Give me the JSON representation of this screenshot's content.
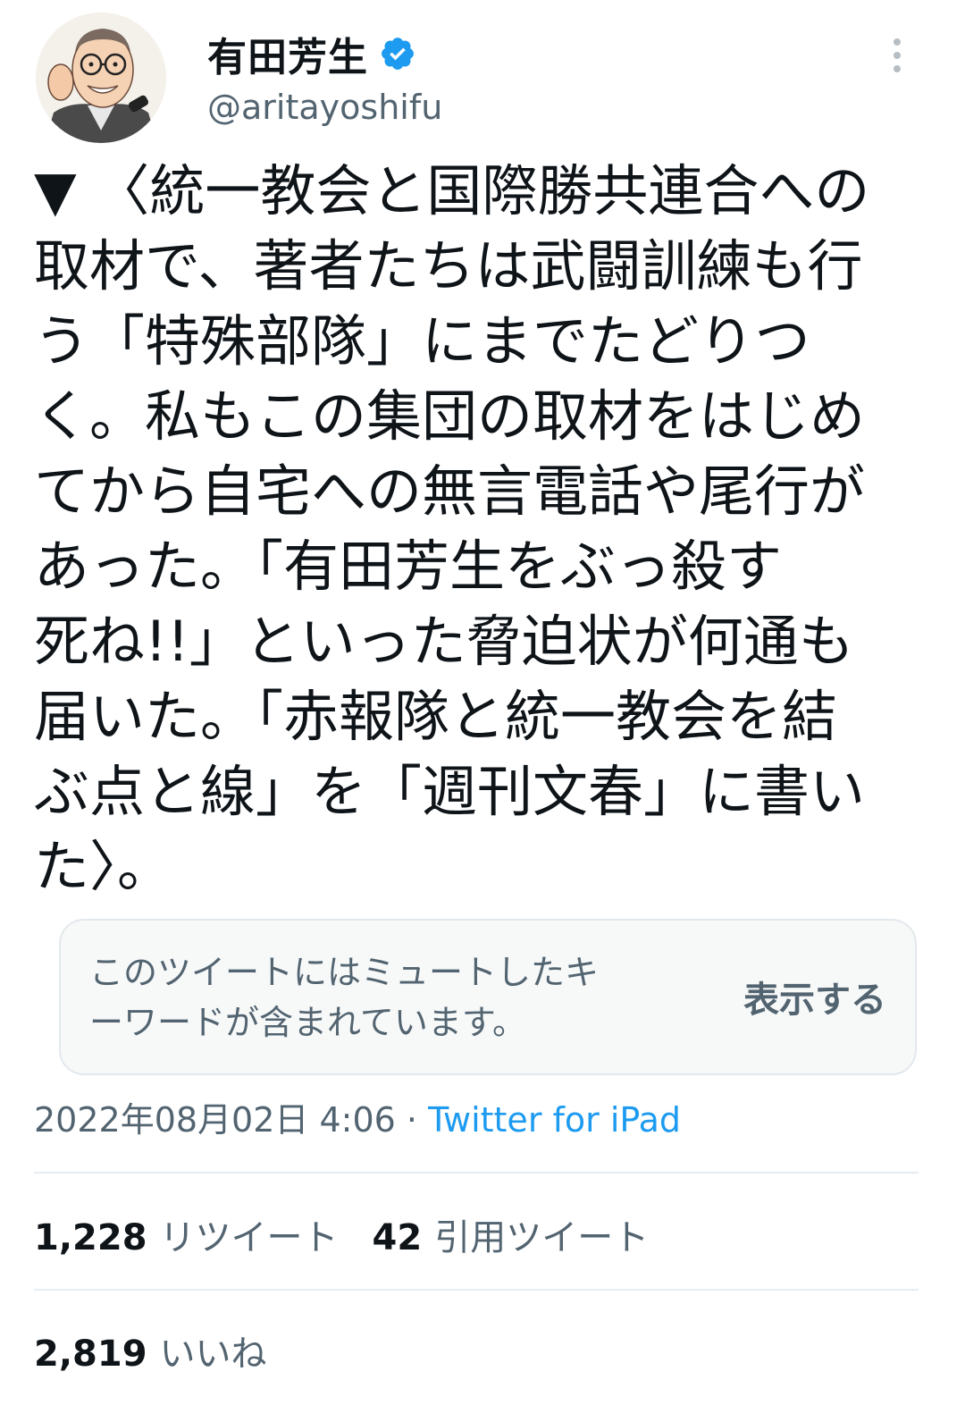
{
  "author": {
    "display_name": "有田芳生",
    "handle": "@aritayoshifu",
    "verified_color": "#1d9bf0"
  },
  "tweet": {
    "lines": [
      "▼ 〈統一教会と国際勝共連合への",
      "取材で、著者たちは武闘訓練も行",
      "う「特殊部隊」にまでたどりつ",
      "く。私もこの集団の取材をはじめ",
      "てから自宅への無言電話や尾行が",
      "あった。「有田芳生をぶっ殺す",
      "死ね!!」といった脅迫状が何通も",
      "届いた。「赤報隊と統一教会を結",
      "ぶ点と線」を「週刊文春」に書い",
      "た〉。"
    ]
  },
  "muted_notice": {
    "lines": [
      "このツイートにはミュートしたキ",
      "ーワードが含まれています。"
    ],
    "show_label": "表示する"
  },
  "meta": {
    "timestamp": "2022年08月02日 4:06",
    "separator": " · ",
    "source": "Twitter for iPad",
    "source_color": "#1d9bf0"
  },
  "stats": {
    "retweets": {
      "count": "1,228",
      "label": "リツイート"
    },
    "quotes": {
      "count": "42",
      "label": "引用ツイート"
    },
    "likes": {
      "count": "2,819",
      "label": "いいね"
    }
  },
  "icons": {
    "verified": "verified-badge-icon",
    "more": "more-options-icon"
  }
}
